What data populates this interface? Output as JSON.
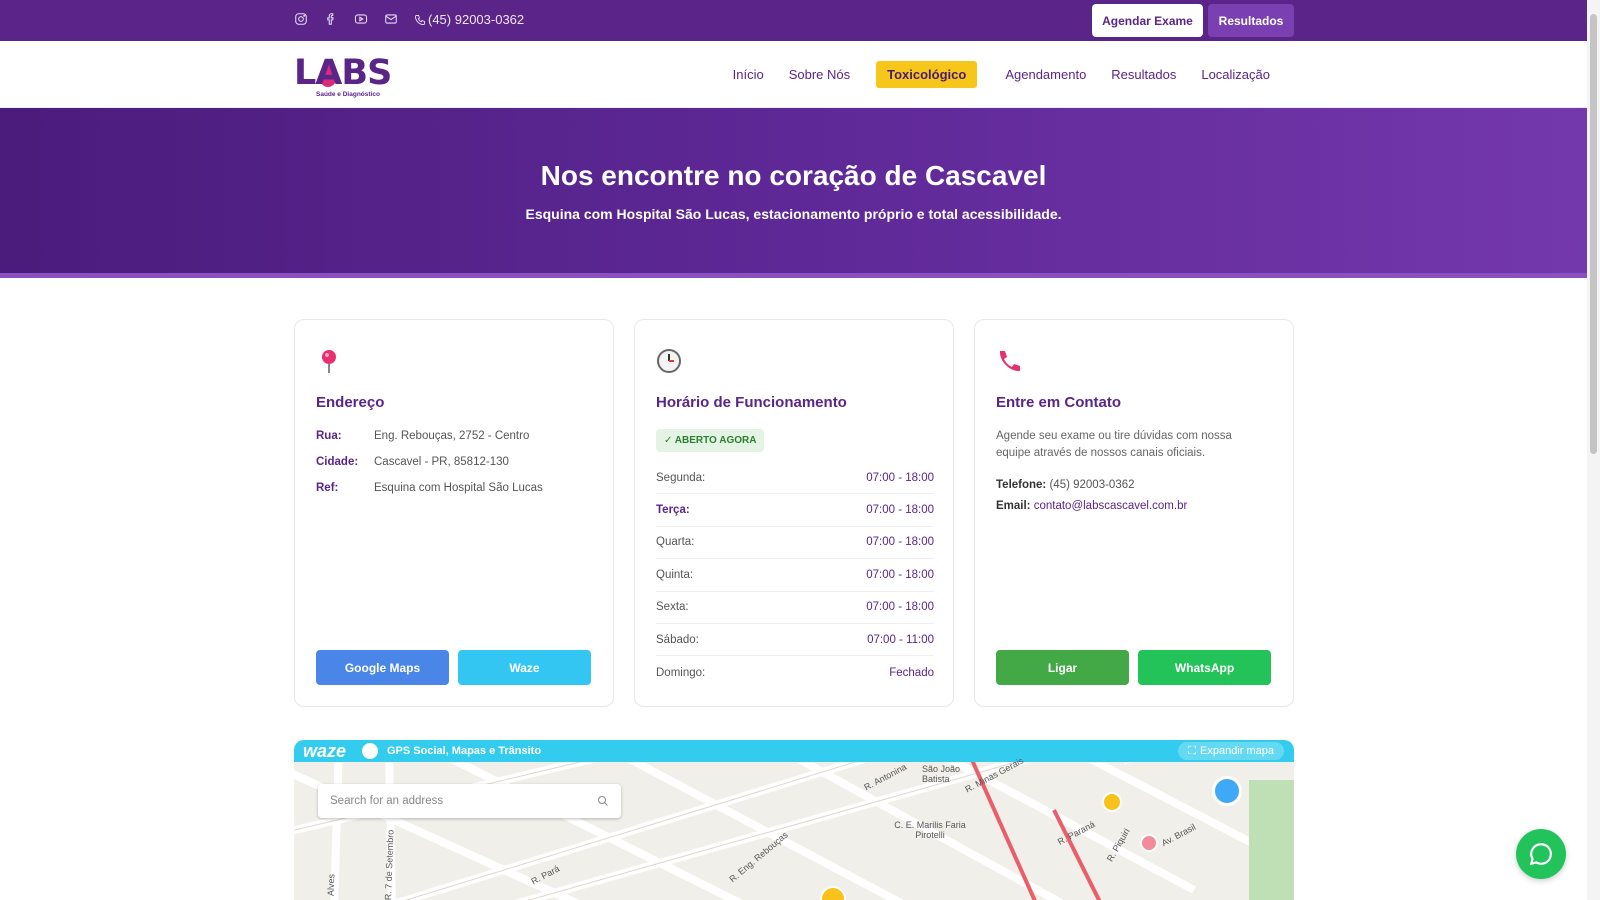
{
  "topbar": {
    "phone": "(45) 92003-0362",
    "agendar_label": "Agendar Exame",
    "resultados_label": "Resultados"
  },
  "brand": {
    "logo_text": "LABS",
    "tagline": "Saúde e Diagnóstico"
  },
  "nav": {
    "items": [
      {
        "label": "Início"
      },
      {
        "label": "Sobre Nós"
      },
      {
        "label": "Toxicológico"
      },
      {
        "label": "Agendamento"
      },
      {
        "label": "Resultados"
      },
      {
        "label": "Localização"
      }
    ],
    "highlighted": "Toxicológico"
  },
  "hero": {
    "title": "Nos encontre no coração de Cascavel",
    "subtitle": "Esquina com Hospital São Lucas, estacionamento próprio e total acessibilidade."
  },
  "address_card": {
    "title": "Endereço",
    "rows": [
      {
        "key": "Rua:",
        "value": "Eng. Rebouças, 2752 - Centro"
      },
      {
        "key": "Cidade:",
        "value": "Cascavel - PR, 85812-130"
      },
      {
        "key": "Ref:",
        "value": "Esquina com Hospital São Lucas"
      }
    ],
    "google_maps_label": "Google Maps",
    "waze_label": "Waze"
  },
  "hours_card": {
    "title": "Horário de Funcionamento",
    "status": "✓ ABERTO AGORA",
    "today": "Terça:",
    "rows": [
      {
        "day": "Segunda:",
        "time": "07:00 - 18:00"
      },
      {
        "day": "Terça:",
        "time": "07:00 - 18:00"
      },
      {
        "day": "Quarta:",
        "time": "07:00 - 18:00"
      },
      {
        "day": "Quinta:",
        "time": "07:00 - 18:00"
      },
      {
        "day": "Sexta:",
        "time": "07:00 - 18:00"
      },
      {
        "day": "Sábado:",
        "time": "07:00 - 11:00"
      },
      {
        "day": "Domingo:",
        "time": "Fechado"
      }
    ]
  },
  "contact_card": {
    "title": "Entre em Contato",
    "description": "Agende seu exame ou tire dúvidas com nossa equipe através de nossos canais oficiais.",
    "phone_label": "Telefone:",
    "phone_value": "(45) 92003-0362",
    "email_label": "Email:",
    "email_value": "contato@labscascavel.com.br",
    "ligar_label": "Ligar",
    "whatsapp_label": "WhatsApp"
  },
  "map": {
    "brand": "waze",
    "subtitle": "GPS Social, Mapas e Trânsito",
    "expand_label": "Expandir mapa",
    "search_placeholder": "Search for an address",
    "street_labels": [
      "R. Antonina",
      "São João Batista",
      "R. Minas Gerais",
      "C. E. Marilis Faria Pirotelli",
      "R. Paraná",
      "R. Piquiri",
      "Av. Brasil",
      "R. Pará",
      "R. Eng. Rebouças",
      "R. 7 de Setembro",
      "Alves"
    ]
  },
  "colors": {
    "primary": "#5b2489",
    "accent": "#f7c61b",
    "google_maps": "#4a86e8",
    "waze": "#34c6f2",
    "call": "#43a947",
    "whatsapp": "#23c35a"
  }
}
